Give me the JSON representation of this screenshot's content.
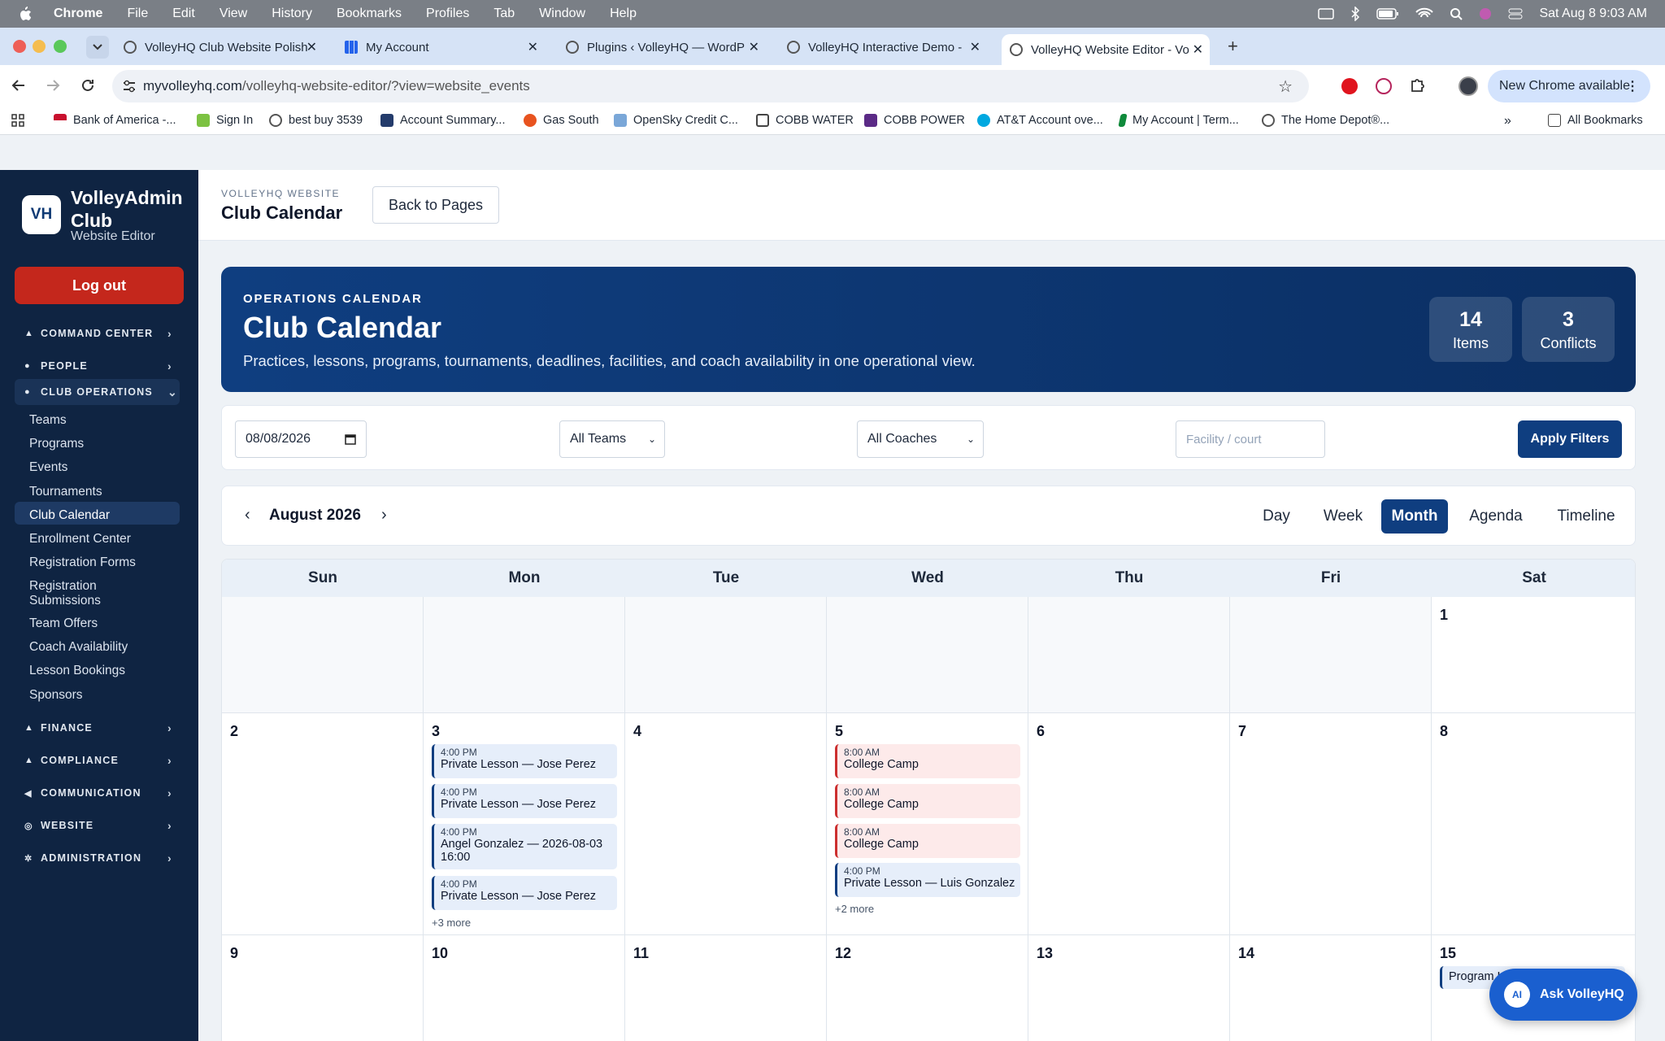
{
  "os_menubar": {
    "app": "Chrome",
    "items": [
      "File",
      "Edit",
      "View",
      "History",
      "Bookmarks",
      "Profiles",
      "Tab",
      "Window",
      "Help"
    ],
    "clock": "Sat Aug 8  9:03 AM"
  },
  "browser": {
    "tabs": [
      {
        "title": "VolleyHQ Club Website Polish"
      },
      {
        "title": "My Account"
      },
      {
        "title": "Plugins ‹ VolleyHQ — WordPr"
      },
      {
        "title": "VolleyHQ Interactive Demo - "
      },
      {
        "title": "VolleyHQ Website Editor - Vo"
      }
    ],
    "url_host": "myvolleyhq.com",
    "url_path": "/volleyhq-website-editor/?view=website_events",
    "update_label": "New Chrome available",
    "bookmarks": [
      {
        "label": "Bank of America -..."
      },
      {
        "label": "Sign In"
      },
      {
        "label": "best buy 3539"
      },
      {
        "label": "Account Summary..."
      },
      {
        "label": "Gas South"
      },
      {
        "label": "OpenSky Credit C..."
      },
      {
        "label": "COBB WATER"
      },
      {
        "label": "COBB POWER"
      },
      {
        "label": "AT&T Account ove..."
      },
      {
        "label": "My Account | Term..."
      },
      {
        "label": "The Home Depot®..."
      }
    ],
    "all_bookmarks": "All Bookmarks"
  },
  "sidebar": {
    "logo": "VH",
    "brand_name": "VolleyAdmin Club",
    "brand_sub": "Website Editor",
    "logout_label": "Log out",
    "sections": {
      "command_center": "COMMAND CENTER",
      "people": "PEOPLE",
      "club_operations": "CLUB OPERATIONS",
      "finance": "FINANCE",
      "compliance": "COMPLIANCE",
      "communication": "COMMUNICATION",
      "website": "WEBSITE",
      "administration": "ADMINISTRATION"
    },
    "club_ops_items": [
      "Teams",
      "Programs",
      "Events",
      "Tournaments",
      "Club Calendar",
      "Enrollment Center",
      "Registration Forms",
      "Registration Submissions",
      "Team Offers",
      "Coach Availability",
      "Lesson Bookings",
      "Sponsors"
    ],
    "selected": "Club Calendar"
  },
  "header": {
    "eyebrow": "VOLLEYHQ WEBSITE",
    "title": "Club Calendar",
    "back_label": "Back to Pages"
  },
  "hero": {
    "eyebrow": "OPERATIONS CALENDAR",
    "title": "Club Calendar",
    "description": "Practices, lessons, programs, tournaments, deadlines, facilities, and coach availability in one operational view.",
    "stats": [
      {
        "value": "14",
        "label": "Items"
      },
      {
        "value": "3",
        "label": "Conflicts"
      }
    ]
  },
  "filters": {
    "date_value": "08/08/2026",
    "team_select": "All Teams",
    "coach_select": "All Coaches",
    "facility_placeholder": "Facility / court",
    "apply_label": "Apply Filters"
  },
  "calendar": {
    "month_label": "August 2026",
    "prev_icon": "chevron-left-icon",
    "next_icon": "chevron-right-icon",
    "views": [
      "Day",
      "Week",
      "Month",
      "Agenda",
      "Timeline"
    ],
    "active_view": "Month",
    "weekdays": [
      "Sun",
      "Mon",
      "Tue",
      "Wed",
      "Thu",
      "Fri",
      "Sat"
    ],
    "week1": [
      "",
      "",
      "",
      "",
      "",
      "",
      "1"
    ],
    "week2": [
      "2",
      "3",
      "4",
      "5",
      "6",
      "7",
      "8"
    ],
    "week3": [
      "9",
      "10",
      "11",
      "12",
      "13",
      "14",
      "15"
    ],
    "events_aug3": [
      {
        "time": "4:00 PM",
        "name": "Private Lesson — Jose Perez"
      },
      {
        "time": "4:00 PM",
        "name": "Private Lesson — Jose Perez"
      },
      {
        "time": "4:00 PM",
        "name": "Angel Gonzalez — 2026-08-03 16:00"
      },
      {
        "time": "4:00 PM",
        "name": "Private Lesson — Jose Perez"
      }
    ],
    "more_aug3": "+3 more",
    "events_aug5": [
      {
        "time": "8:00 AM",
        "name": "College Camp"
      },
      {
        "time": "8:00 AM",
        "name": "College Camp"
      },
      {
        "time": "8:00 AM",
        "name": "College Camp"
      },
      {
        "time": "4:00 PM",
        "name": "Private Lesson — Luis Gonzalez"
      }
    ],
    "more_aug5": "+2 more",
    "event_aug15": "Program L"
  },
  "assistant": {
    "badge": "AI",
    "label": "Ask VolleyHQ"
  },
  "colors": {
    "sidebar_bg": "#0f2442",
    "primary": "#0f3e80",
    "logout_red": "#c4271c",
    "event_blue_bg": "#e6eefa",
    "event_red_bg": "#fdeaea"
  }
}
